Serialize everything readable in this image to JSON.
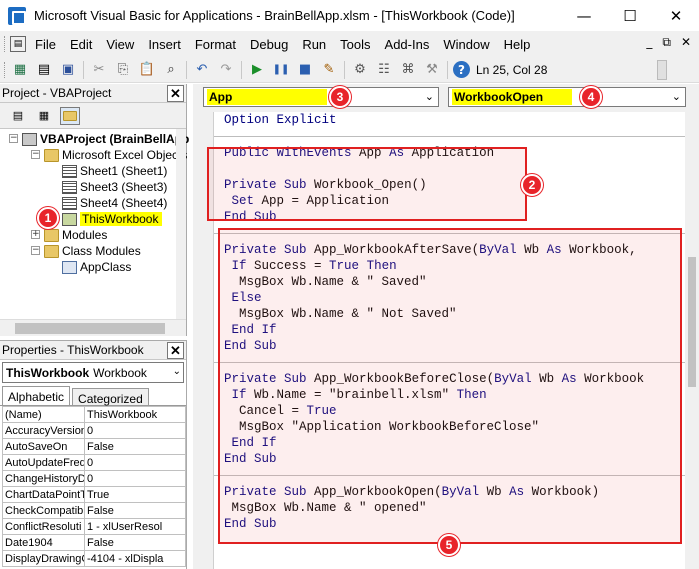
{
  "window": {
    "title": "Microsoft Visual Basic for Applications - BrainBellApp.xlsm - [ThisWorkbook (Code)]",
    "minimize_glyph": "—",
    "maximize_glyph": "☐",
    "close_glyph": "✕"
  },
  "menu": {
    "items": [
      "File",
      "Edit",
      "View",
      "Insert",
      "Format",
      "Debug",
      "Run",
      "Tools",
      "Add-Ins",
      "Window",
      "Help"
    ],
    "child_min": "_",
    "child_restore": "⧉",
    "child_close": "✕"
  },
  "toolbar": {
    "cursor_position": "Ln 25, Col 28"
  },
  "project_explorer": {
    "header": "Project - VBAProject",
    "close": "✕",
    "tree": {
      "project": "VBAProject (BrainBellApp",
      "excel_objects_folder": "Microsoft Excel Objects",
      "sheets": [
        "Sheet1 (Sheet1)",
        "Sheet3 (Sheet3)",
        "Sheet4 (Sheet4)"
      ],
      "this_workbook": "ThisWorkbook",
      "modules_folder": "Modules",
      "class_modules_folder": "Class Modules",
      "class": "AppClass"
    }
  },
  "properties": {
    "header": "Properties - ThisWorkbook",
    "close": "✕",
    "object_name": "ThisWorkbook",
    "object_type": "Workbook",
    "tabs": [
      "Alphabetic",
      "Categorized"
    ],
    "rows": [
      [
        "(Name)",
        "ThisWorkbook"
      ],
      [
        "AccuracyVersion",
        "0"
      ],
      [
        "AutoSaveOn",
        "False"
      ],
      [
        "AutoUpdateFreq",
        "0"
      ],
      [
        "ChangeHistoryD",
        "0"
      ],
      [
        "ChartDataPointT",
        "True"
      ],
      [
        "CheckCompatibil",
        "False"
      ],
      [
        "ConflictResoluti",
        "1 - xlUserResol"
      ],
      [
        "Date1904",
        "False"
      ],
      [
        "DisplayDrawingC",
        "-4104 - xlDispla"
      ]
    ]
  },
  "code_window": {
    "object_combo": "App",
    "procedure_combo": "WorkbookOpen",
    "lines": [
      "Option Explicit",
      "",
      "Public WithEvents App As Application",
      "",
      "Private Sub Workbook_Open()",
      " Set App = Application",
      "End Sub",
      "",
      "Private Sub App_WorkbookAfterSave(ByVal Wb As Workbook, ",
      " If Success = True Then",
      "  MsgBox Wb.Name & \" Saved\"",
      " Else",
      "  MsgBox Wb.Name & \" Not Saved\"",
      " End If",
      "End Sub",
      "",
      "Private Sub App_WorkbookBeforeClose(ByVal Wb As Workbook",
      " If Wb.Name = \"brainbell.xlsm\" Then",
      "  Cancel = True",
      "  MsgBox \"Application WorkbookBeforeClose\"",
      " End If",
      "End Sub",
      "",
      "Private Sub App_WorkbookOpen(ByVal Wb As Workbook)",
      " MsgBox Wb.Name & \" opened\"",
      "End Sub"
    ]
  },
  "annotations": {
    "badges": [
      "1",
      "2",
      "3",
      "4",
      "5"
    ],
    "accent_red": "#e8242a",
    "highlight_yellow": "#ffff00"
  }
}
